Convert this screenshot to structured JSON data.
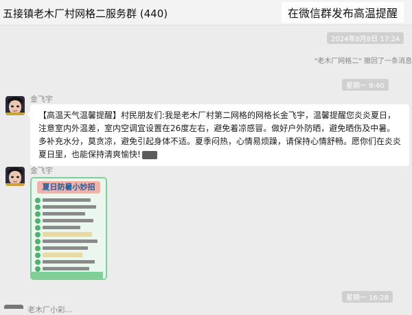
{
  "chat": {
    "title": "五接镇老木厂村网格二服务群 (440)"
  },
  "overlay_caption": "在微信群发布高温提醒",
  "timeline": {
    "ts1": "2024年8月8日 17:24",
    "system_message": "\"老木厂网格二\" 撤回了一条消息",
    "ts2": "星期一 9:40",
    "ts3": "星期一 16:28"
  },
  "messages": [
    {
      "sender": "金飞宇",
      "text": "【高温天气温馨提醒】村民朋友们:我是老木厂村第二网格的网格长金飞宇，温馨提醒您炎炎夏日，注意室内外温差，室内空调宜设置在26度左右，避免着凉感冒。做好户外防晒，避免晒伤及中暑。多补充水分，莫贪凉，避免引起身体不适。夏季闷热，心情易烦躁，请保持心情舒畅。愿你们在炎炎夏日里，也能保持清爽愉快!"
    },
    {
      "sender": "金飞宇",
      "image_title": "夏日防暑小妙招"
    }
  ],
  "bottom_partial_sender": "老木厂小彩...",
  "colors": {
    "background": "#ececec",
    "bubble": "#ffffff",
    "timestamp_pill": "#d0d0d0",
    "poster_border": "#7fcf96",
    "poster_title_bg": "#f2b2aa",
    "poster_title_text": "#1f5a99"
  },
  "icons": [
    "avatar-icon",
    "sticker-icon"
  ]
}
